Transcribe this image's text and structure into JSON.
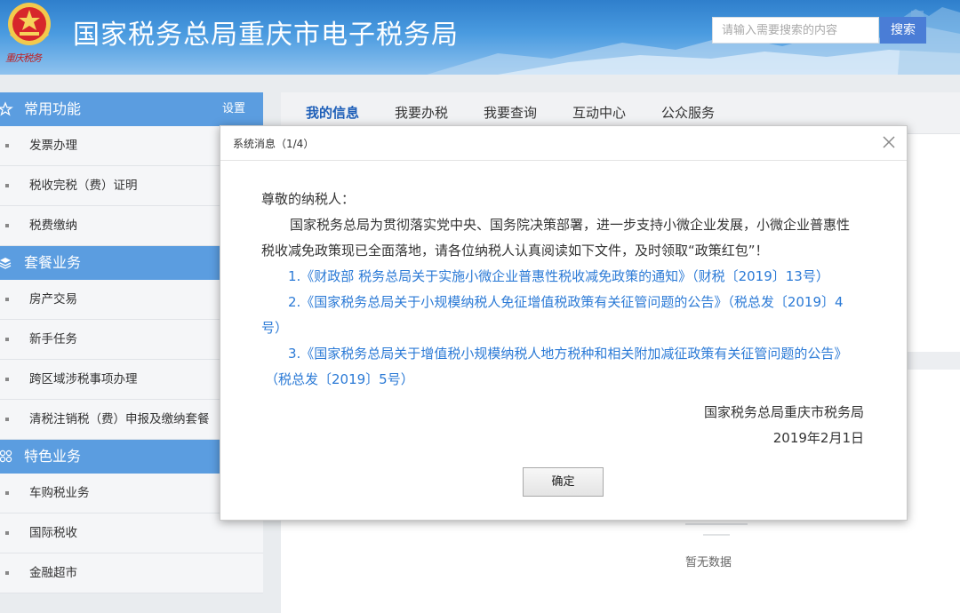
{
  "header": {
    "site_title": "国家税务总局重庆市电子税务局",
    "emblem_text": "重庆税务",
    "search": {
      "placeholder": "请输入需要搜索的内容",
      "button_label": "搜索"
    }
  },
  "sidebar": {
    "sections": [
      {
        "title": "常用功能",
        "setting_label": "设置",
        "icon": "star-icon",
        "items": [
          "发票办理",
          "税收完税（费）证明",
          "税费缴纳"
        ]
      },
      {
        "title": "套餐业务",
        "icon": "layers-icon",
        "items": [
          "房产交易",
          "新手任务",
          "跨区域涉税事项办理",
          "清税注销税（费）申报及缴纳套餐"
        ]
      },
      {
        "title": "特色业务",
        "icon": "grid-icon",
        "items": [
          "车购税业务",
          "国际税收",
          "金融超市"
        ]
      }
    ]
  },
  "main": {
    "tabs": [
      "我的信息",
      "我要办税",
      "我要查询",
      "互动中心",
      "公众服务"
    ],
    "active_tab": "我的信息",
    "empty_text": "暂无数据"
  },
  "modal": {
    "title": "系统消息（1/4）",
    "greeting": "尊敬的纳税人：",
    "paragraph_line1": "国家税务总局为贯彻落实党中央、国务院决策部署，进一步支持小微企业发展，小微企业普惠性",
    "paragraph_line2": "税收减免政策现已全面落地，请各位纳税人认真阅读如下文件，及时领取“政策红包”！",
    "links": [
      {
        "line1": "1.《财政部 税务总局关于实施小微企业普惠性税收减免政策的通知》（财税〔2019〕13号）",
        "line2": ""
      },
      {
        "line1": "2.《国家税务总局关于小规模纳税人免征增值税政策有关征管问题的公告》（税总发〔2019〕4",
        "line2": "号）"
      },
      {
        "line1": "3.《国家税务总局关于增值税小规模纳税人地方税种和相关附加减征政策有关征管问题的公告》",
        "line2": "（税总发〔2019〕5号）"
      }
    ],
    "signature_org": "国家税务总局重庆市税务局",
    "signature_date": "2019年2月1日",
    "ok_label": "确定"
  },
  "colors": {
    "header_blue": "#2f7fcc",
    "sidebar_header": "#5b9de0",
    "link_blue": "#2b7ad6",
    "active_tab": "#1e5fb8",
    "search_button": "#4a7dd6",
    "emblem_red": "#c31c1c"
  }
}
